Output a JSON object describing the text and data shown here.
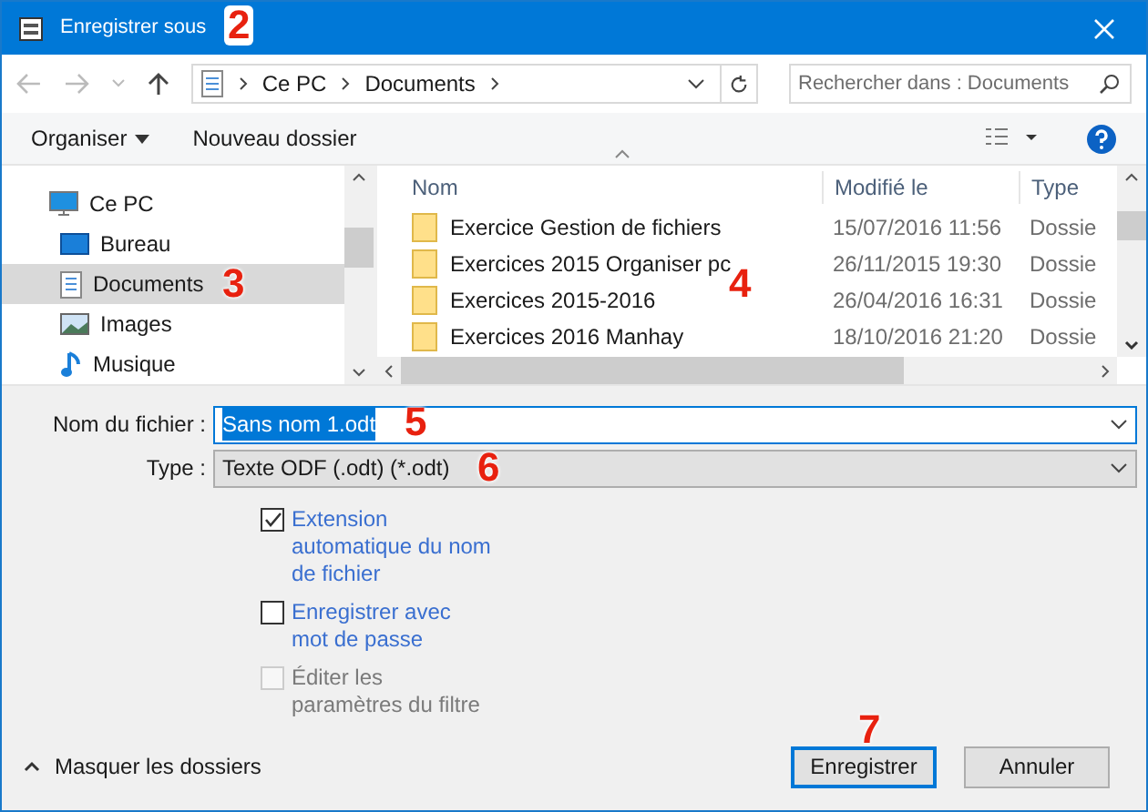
{
  "window": {
    "title": "Enregistrer sous"
  },
  "address": {
    "crumbs": [
      "Ce PC",
      "Documents"
    ]
  },
  "search": {
    "placeholder": "Rechercher dans : Documents"
  },
  "toolbar": {
    "organize": "Organiser",
    "new_folder": "Nouveau dossier"
  },
  "sidebar": {
    "items": [
      {
        "label": "Ce PC",
        "kind": "pc",
        "selected": false,
        "children": [
          {
            "label": "Bureau",
            "kind": "desktop",
            "selected": false
          },
          {
            "label": "Documents",
            "kind": "documents",
            "selected": true
          },
          {
            "label": "Images",
            "kind": "images",
            "selected": false
          },
          {
            "label": "Musique",
            "kind": "music",
            "selected": false
          }
        ]
      }
    ]
  },
  "table": {
    "columns": [
      "Nom",
      "Modifié le",
      "Type"
    ],
    "rows": [
      {
        "name": "Exercice Gestion de fichiers",
        "modified": "15/07/2016 11:56",
        "type": "Dossie"
      },
      {
        "name": "Exercices 2015 Organiser pc",
        "modified": "26/11/2015 19:30",
        "type": "Dossie"
      },
      {
        "name": "Exercices 2015-2016",
        "modified": "26/04/2016 16:31",
        "type": "Dossie"
      },
      {
        "name": "Exercices 2016 Manhay",
        "modified": "18/10/2016 21:20",
        "type": "Dossie"
      }
    ]
  },
  "filename": {
    "label": "Nom du fichier :",
    "value": "Sans nom 1.odt"
  },
  "filetype": {
    "label": "Type :",
    "value": "Texte ODF (.odt) (*.odt)"
  },
  "options": [
    {
      "label": "Extension automatique du nom de fichier",
      "checked": true,
      "disabled": false
    },
    {
      "label": "Enregistrer avec mot de passe",
      "checked": false,
      "disabled": false
    },
    {
      "label": "Éditer les paramètres du filtre",
      "checked": false,
      "disabled": true
    }
  ],
  "hide_folders": "Masquer les dossiers",
  "buttons": [
    {
      "label": "Enregistrer",
      "kind": "primary"
    },
    {
      "label": "Annuler",
      "kind": "secondary"
    }
  ],
  "annotations": [
    "2",
    "3",
    "4",
    "5",
    "6",
    "7"
  ]
}
